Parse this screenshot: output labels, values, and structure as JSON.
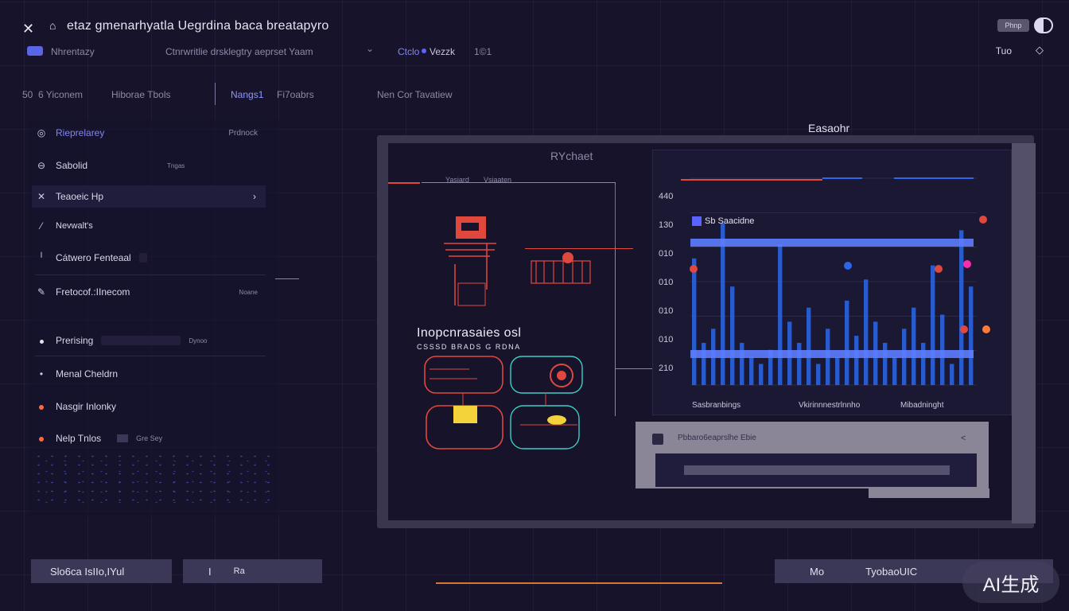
{
  "window": {
    "title": "etaz gmenarhyatla Uegrdina baca breatapyro",
    "pill_label": "Phnp"
  },
  "toolbar": {
    "left_label": "Nhrentazy",
    "center_label": "Ctnrwritlie drsklegtry aeprset Yaam",
    "accent_label": "Ctclo",
    "accent_label_2": "Vezzk",
    "accent_num": "1©1",
    "right_label": "Tuo"
  },
  "tabs": {
    "left_num": "50",
    "left_label": "6 Yiconem",
    "tab2": "Hiborae Tbols",
    "active": "Nangs1",
    "active_2": "Fi7oabrs",
    "tab4": "Nen Cor Tavatiew"
  },
  "sidebar": {
    "items": [
      {
        "label": "Rieprelarey",
        "hint": "Prdnock"
      },
      {
        "label": "Sabolid",
        "hint": "Tngas"
      },
      {
        "label": "Teaoeic Hp"
      },
      {
        "label": "Nevwalt's"
      },
      {
        "label": "Cátwero Fenteaal"
      },
      {
        "label": "Fretocof.:IInecom",
        "hint": "Noane"
      },
      {
        "label": "Prerising",
        "hint": "Dynoo"
      },
      {
        "label": "Menal Cheldrn"
      },
      {
        "label": "Nasgir Inlonky"
      },
      {
        "label": "Nelp Tnlos",
        "hint": "Gre Sey"
      }
    ]
  },
  "card": {
    "title": "RYchaet",
    "sub_left": "Yasiard",
    "sub_right": "Vsiaaten",
    "heading": "Easaohr",
    "insight_title": "Inopcnrasaies osl",
    "insight_sub": "CSSSD BRADS G RDNA"
  },
  "chart_data": {
    "type": "bar",
    "y_ticks": [
      "440",
      "130",
      "010",
      "010",
      "010",
      "010",
      "210"
    ],
    "legend": "Sb Saacidne",
    "x_labels": [
      "Sasbranbings",
      "Vkirinnnestrlnnho",
      "Mibadninght"
    ],
    "values": [
      180,
      60,
      80,
      230,
      140,
      60,
      40,
      30,
      50,
      200,
      90,
      60,
      110,
      30,
      80,
      40,
      120,
      70,
      150,
      90,
      60,
      40,
      80,
      110,
      60,
      170,
      100,
      30,
      220,
      140
    ],
    "ylim": [
      0,
      260
    ],
    "colors": {
      "bar": "#2b67e8",
      "band": "#5e7dff",
      "red": "#e0483e"
    }
  },
  "dialog": {
    "text": "Pbbaro6eaprslhe Ebie",
    "chevron": "<"
  },
  "footer": {
    "btn1": "Slo6ca IsIIo,IYul",
    "btn2_icon": "I",
    "btn2_icon2": "Ra",
    "btn3_left": "Mo",
    "btn3_right": "TyobaoUIC"
  },
  "watermark": "AI生成"
}
